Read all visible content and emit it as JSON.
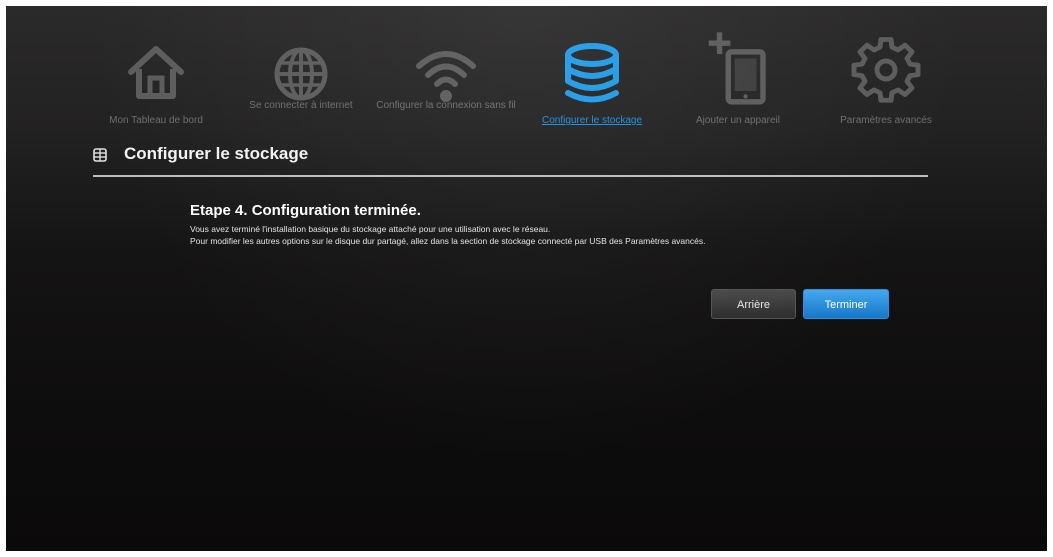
{
  "nav": {
    "items": [
      {
        "label": "Mon Tableau de bord",
        "icon": "home-icon",
        "active": false
      },
      {
        "label": "Se connecter à internet",
        "icon": "globe-icon",
        "active": false
      },
      {
        "label": "Configurer la connexion sans fil",
        "icon": "wifi-icon",
        "active": false
      },
      {
        "label": "Configurer le stockage",
        "icon": "storage-icon",
        "active": true
      },
      {
        "label": "Ajouter un appareil",
        "icon": "add-device-icon",
        "active": false
      },
      {
        "label": "Paramètres avancés",
        "icon": "gear-icon",
        "active": false
      }
    ]
  },
  "section": {
    "icon": "grid-icon",
    "title": "Configurer le stockage"
  },
  "content": {
    "step_title": "Etape 4. Configuration terminée.",
    "line1": "Vous avez terminé l'installation basique du stockage attaché pour une utilisation avec le réseau.",
    "line2": "Pour modifier les autres options sur le disque dur partagé, allez dans la section de stockage connecté par USB des Paramètres avancés."
  },
  "buttons": {
    "back": "Arrière",
    "finish": "Terminer"
  },
  "colors": {
    "accent": "#1a8fe0",
    "icon_inactive": "#5c5c5c",
    "icon_active": "#1e9be8"
  }
}
